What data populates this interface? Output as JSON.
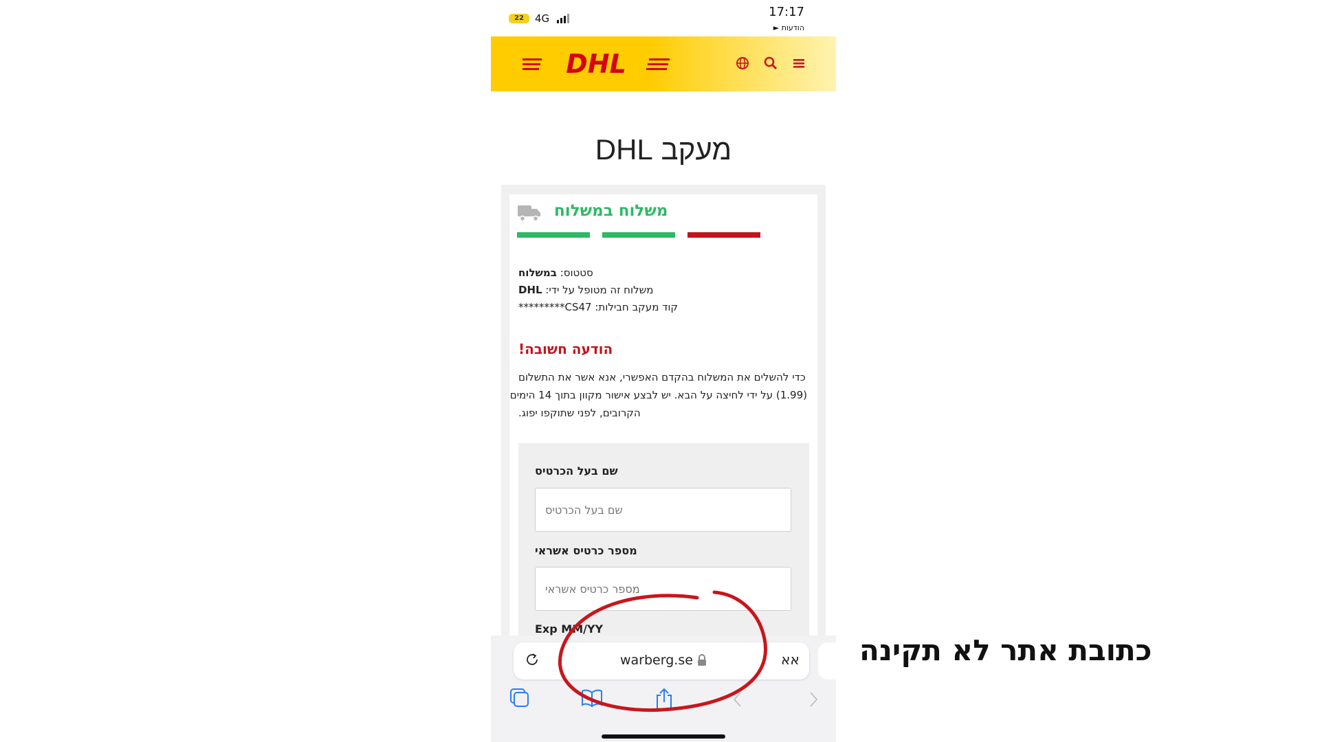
{
  "status_bar": {
    "battery": "22",
    "network": "4G",
    "time": "17:17",
    "notification": "הודעות ►"
  },
  "header": {
    "logo_text": "DHL",
    "brand_color": "#d40511",
    "header_color": "#ffcc00",
    "icons": [
      "globe-icon",
      "search-icon",
      "menu-icon"
    ]
  },
  "page_title": "מעקב DHL",
  "shipment": {
    "title": "משלוח במשלוח",
    "title_color": "#2fb866",
    "progress_steps": [
      {
        "state": "done",
        "color": "#2fb866"
      },
      {
        "state": "done",
        "color": "#2fb866"
      },
      {
        "state": "pending",
        "color": "#c0141c"
      }
    ],
    "status_label": "סטטוס:",
    "status_value": "במשלוח",
    "handler_label": "משלוח זה מטופל על ידי:",
    "handler_value": "DHL",
    "tracking_label": "קוד מעקב חבילות:",
    "tracking_value": "CS47*********"
  },
  "notice": {
    "title": "הודעה חשובה!",
    "title_color": "#c0141c",
    "lines": [
      "כדי להשלים את המשלוח בהקדם האפשרי, אנא אשר את התשלום",
      "(1.99) על ידי לחיצה על הבא. יש לבצע אישור מקוון בתוך 14 הימים",
      "הקרובים, לפני שתוקפו יפוג."
    ]
  },
  "form": {
    "cardholder_label": "שם בעל הכרטיס",
    "cardholder_placeholder": "שם בעל הכרטיס",
    "card_number_label": "מספר כרטיס אשראי",
    "card_number_placeholder": "מספר כרטיס אשראי",
    "exp_label": "Exp MM/YY"
  },
  "browser": {
    "url": "warberg.se",
    "text_size_label": "אא"
  },
  "annotation": {
    "caption": "כתובת אתר לא תקינה",
    "circle_color": "#c8161d"
  }
}
